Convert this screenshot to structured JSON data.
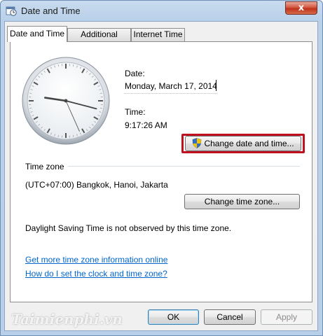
{
  "window": {
    "title": "Date and Time",
    "close_label": "x"
  },
  "tabs": [
    {
      "label": "Date and Time",
      "active": true
    },
    {
      "label": "Additional Clocks",
      "active": false
    },
    {
      "label": "Internet Time",
      "active": false
    }
  ],
  "date": {
    "label": "Date:",
    "value": "Monday, March 17, 2014"
  },
  "time": {
    "label": "Time:",
    "value": "9:17:26 AM"
  },
  "clock": {
    "hour": 9,
    "minute": 17,
    "second": 26
  },
  "buttons": {
    "change_date_time": "Change date and time...",
    "change_time_zone": "Change time zone...",
    "ok": "OK",
    "cancel": "Cancel",
    "apply": "Apply"
  },
  "timezone": {
    "section_label": "Time zone",
    "value": "(UTC+07:00) Bangkok, Hanoi, Jakarta",
    "dst_note": "Daylight Saving Time is not observed by this time zone."
  },
  "links": {
    "more_info": "Get more time zone information online",
    "how_to": "How do I set the clock and time zone?"
  },
  "watermark": "Taimienphi.vn",
  "colors": {
    "highlight": "#c01020",
    "link": "#0066cc"
  }
}
